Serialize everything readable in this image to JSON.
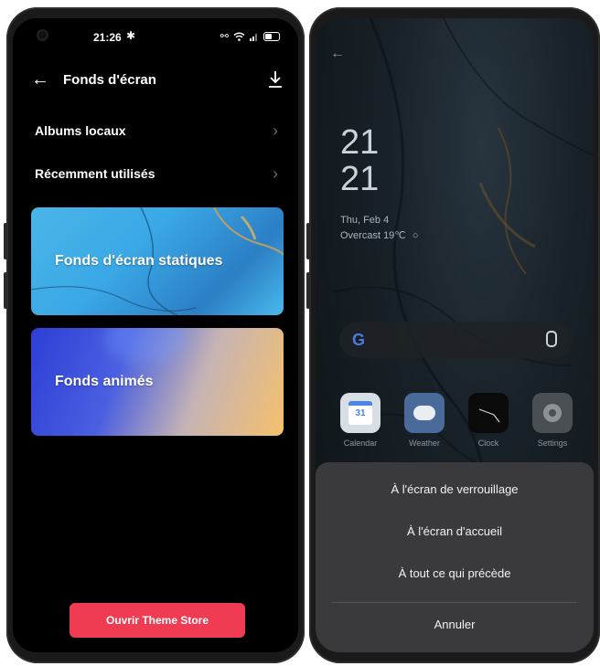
{
  "left_phone": {
    "status": {
      "time": "21:26"
    },
    "header": {
      "title": "Fonds d'écran"
    },
    "menu": [
      {
        "label": "Albums locaux"
      },
      {
        "label": "Récemment utilisés"
      }
    ],
    "cards": [
      {
        "label": "Fonds d'écran statiques"
      },
      {
        "label": "Fonds animés"
      }
    ],
    "cta_label": "Ouvrir Theme Store"
  },
  "right_phone": {
    "clock": {
      "hour": "21",
      "minute": "21"
    },
    "date": "Thu, Feb 4",
    "weather": "Overcast 19℃",
    "apps": [
      {
        "name": "Calendar",
        "icon": "calendar-icon",
        "badge": "31"
      },
      {
        "name": "Weather",
        "icon": "weather-icon"
      },
      {
        "name": "Clock",
        "icon": "clock-icon"
      },
      {
        "name": "Settings",
        "icon": "settings-icon"
      }
    ],
    "sheet": {
      "options": [
        {
          "label": "À l'écran de verrouillage"
        },
        {
          "label": "À l'écran d'accueil"
        },
        {
          "label": "À tout ce qui précède"
        }
      ],
      "cancel_label": "Annuler"
    }
  }
}
